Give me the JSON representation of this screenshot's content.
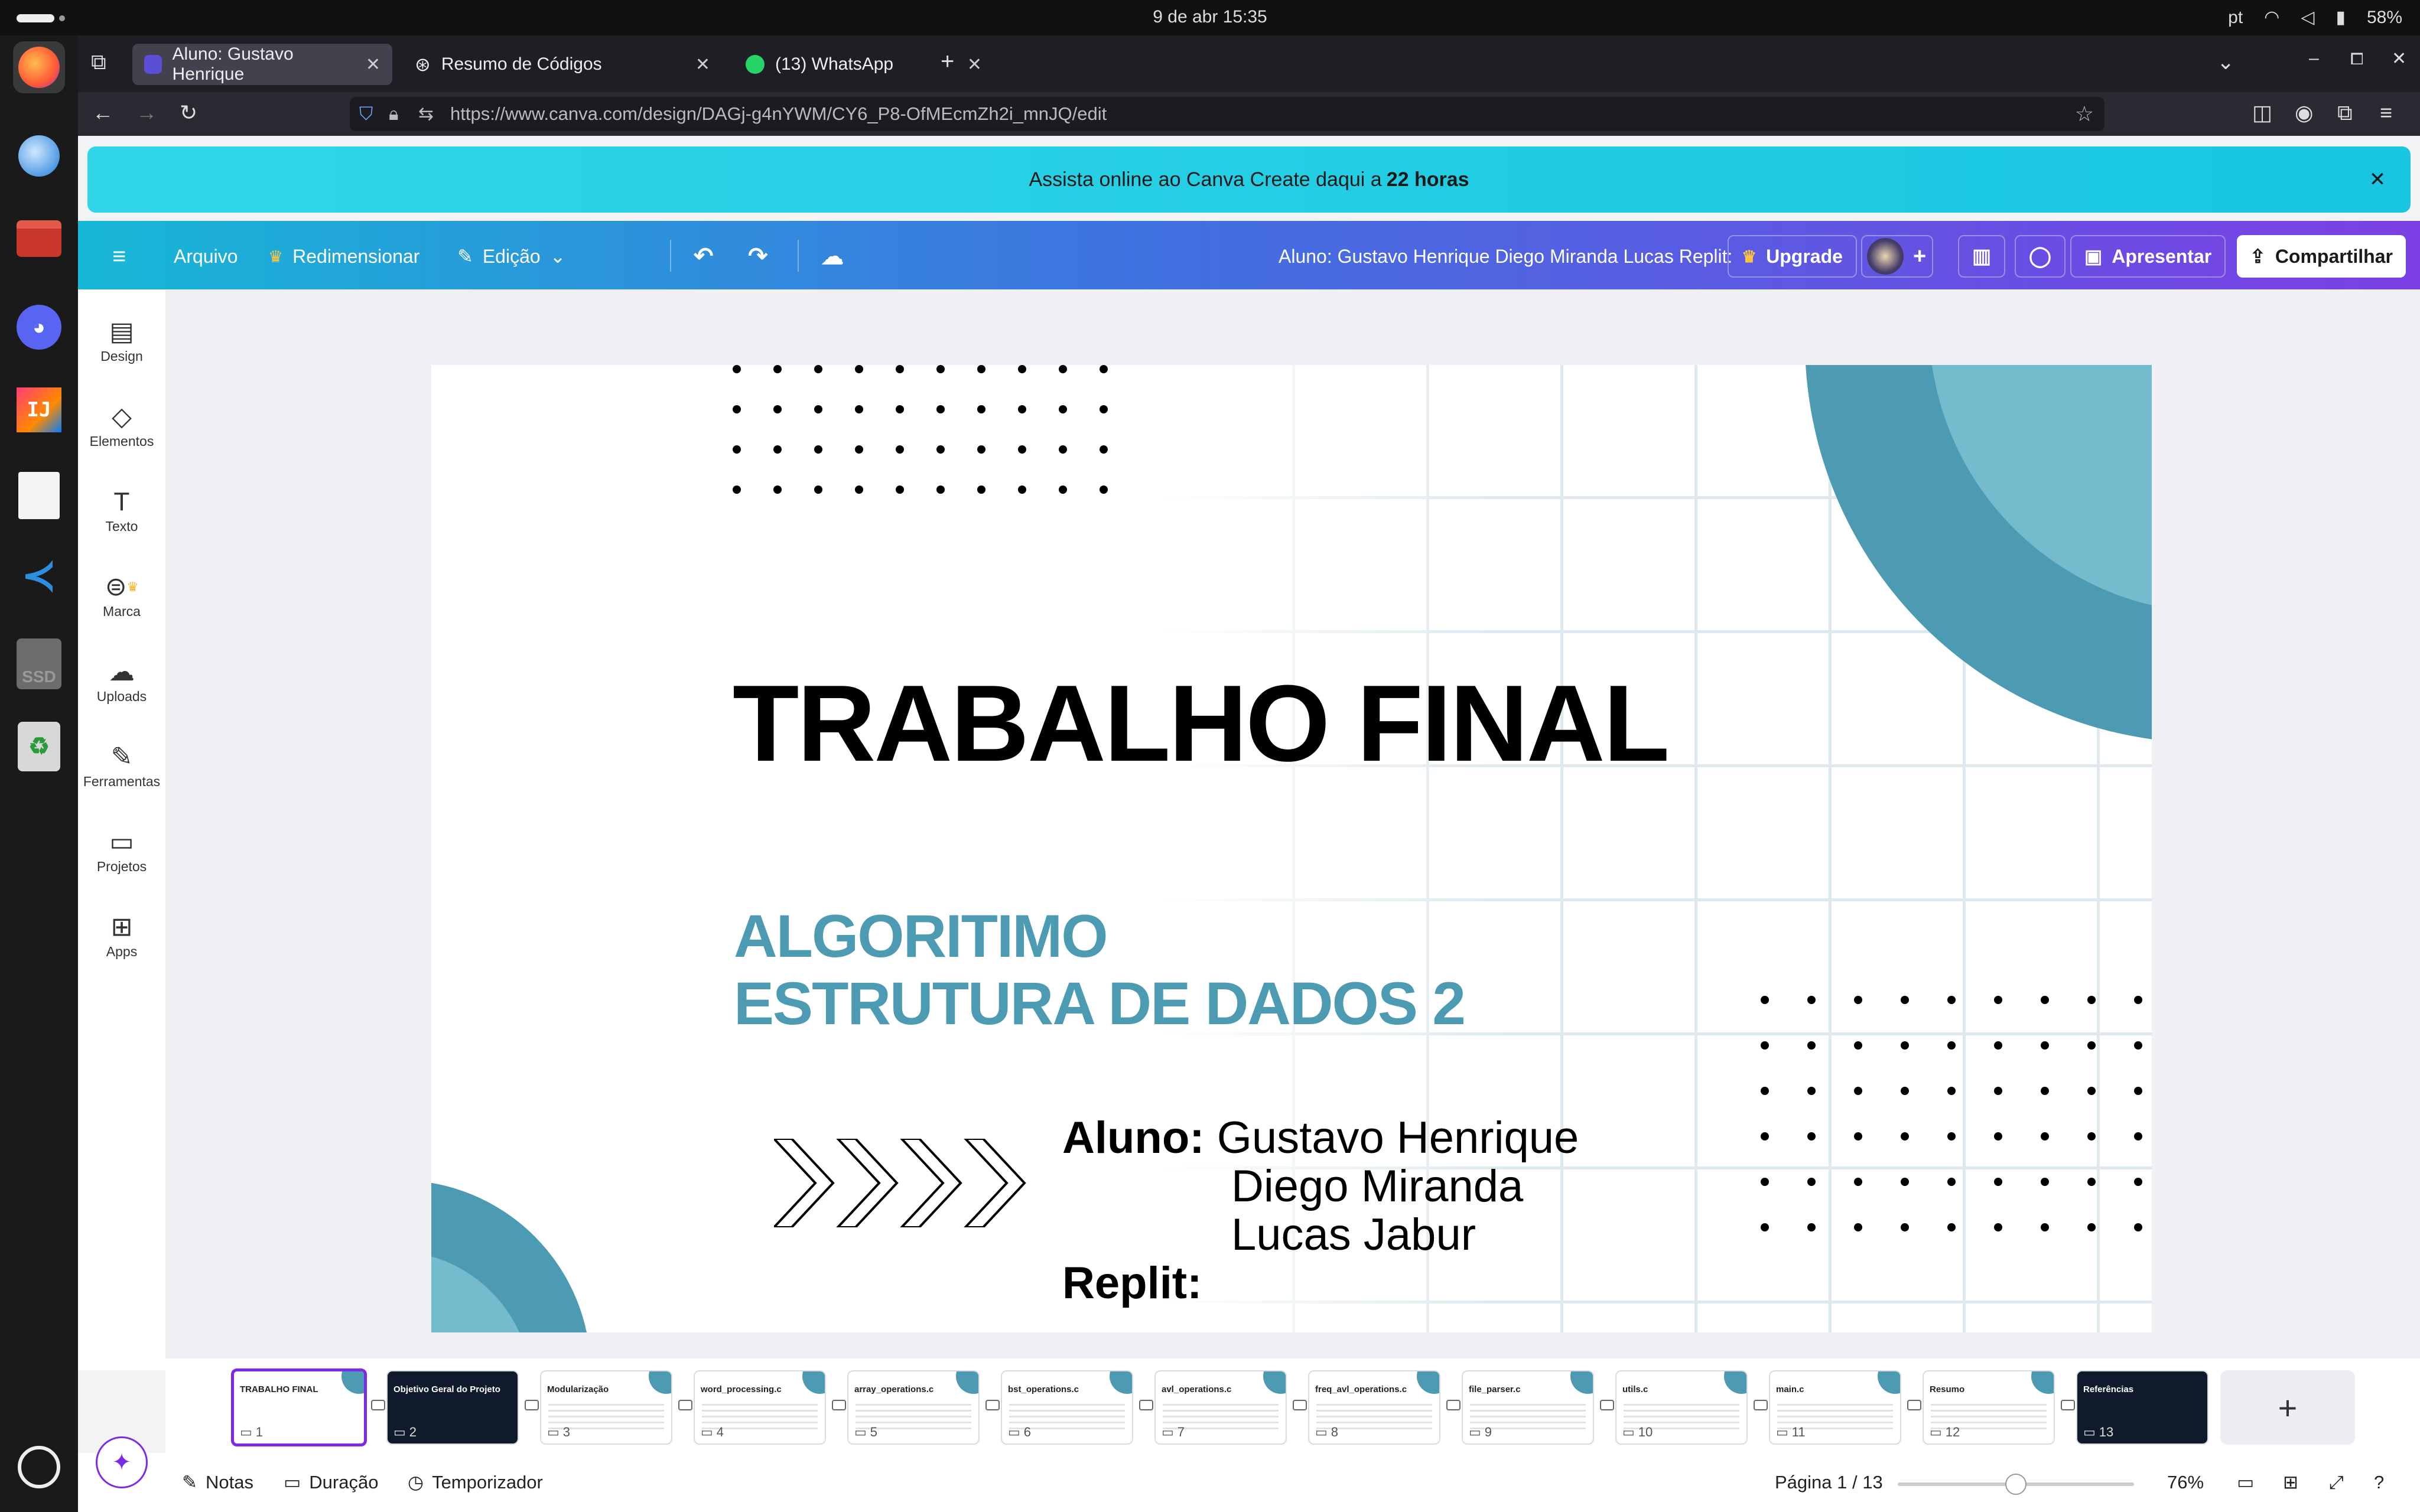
{
  "os": {
    "clock": "9 de abr  15:35",
    "lang": "pt",
    "battery": "58%"
  },
  "browser": {
    "tabs": [
      {
        "label": "Aluno: Gustavo Henrique"
      },
      {
        "label": "Resumo de Códigos"
      },
      {
        "label": "(13) WhatsApp"
      }
    ],
    "url": "https://www.canva.com/design/DAGj-g4nYWM/CY6_P8-OfMEcmZh2i_mnJQ/edit"
  },
  "banner": {
    "text": "Assista online ao Canva Create daqui a",
    "highlight": "22 horas"
  },
  "toolbar": {
    "arquivo": "Arquivo",
    "redimensionar": "Redimensionar",
    "edicao": "Edição",
    "doc_title": "Aluno: Gustavo Henrique Diego Miranda Lucas Replit:",
    "upgrade": "Upgrade",
    "apresentar": "Apresentar",
    "compartilhar": "Compartilhar"
  },
  "sidebar": {
    "items": [
      {
        "label": "Design",
        "icon": "design-icon"
      },
      {
        "label": "Elementos",
        "icon": "elements-icon"
      },
      {
        "label": "Texto",
        "icon": "text-icon"
      },
      {
        "label": "Marca",
        "icon": "brand-icon"
      },
      {
        "label": "Uploads",
        "icon": "upload-icon"
      },
      {
        "label": "Ferramentas",
        "icon": "tools-icon"
      },
      {
        "label": "Projetos",
        "icon": "folder-icon"
      },
      {
        "label": "Apps",
        "icon": "apps-icon"
      }
    ]
  },
  "slide": {
    "title": "TRABALHO FINAL",
    "subtitle_line1": "ALGORITIMO",
    "subtitle_line2": "ESTRUTURA DE DADOS 2",
    "aluno_label": "Aluno:",
    "name1": "Gustavo Henrique",
    "name2": "Diego Miranda",
    "name3": "Lucas Jabur",
    "replit_label": "Replit:"
  },
  "colors": {
    "accent": "#4c9bb2",
    "accent_light": "#74bccd",
    "canva_purple": "#7d2ae8"
  },
  "pages": {
    "thumbs": [
      {
        "num": "1",
        "title": "TRABALHO FINAL"
      },
      {
        "num": "2",
        "title": "Objetivo Geral do Projeto"
      },
      {
        "num": "3",
        "title": "Modularização"
      },
      {
        "num": "4",
        "title": "word_processing.c"
      },
      {
        "num": "5",
        "title": "array_operations.c"
      },
      {
        "num": "6",
        "title": "bst_operations.c"
      },
      {
        "num": "7",
        "title": "avl_operations.c"
      },
      {
        "num": "8",
        "title": "freq_avl_operations.c"
      },
      {
        "num": "9",
        "title": "file_parser.c"
      },
      {
        "num": "10",
        "title": "utils.c"
      },
      {
        "num": "11",
        "title": "main.c"
      },
      {
        "num": "12",
        "title": "Resumo"
      },
      {
        "num": "13",
        "title": "Referências"
      }
    ],
    "add": "+"
  },
  "footer": {
    "notas": "Notas",
    "duracao": "Duração",
    "temporizador": "Temporizador",
    "pagina": "Página 1 / 13",
    "zoom": "76%",
    "zoom_fraction": 0.5
  }
}
